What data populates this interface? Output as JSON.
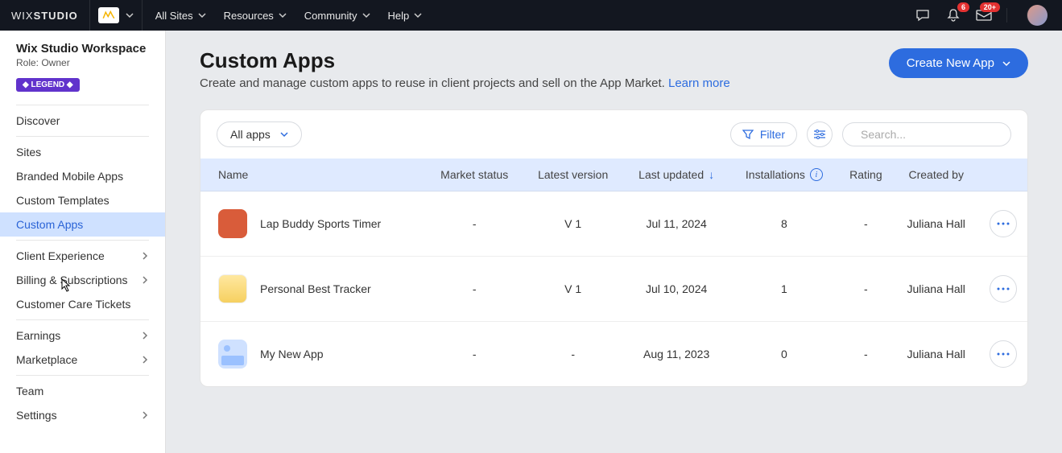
{
  "topbar": {
    "brand_prefix": "WIX ",
    "brand_bold": "STUDIO",
    "site_switch": "All Sites",
    "nav": [
      "Resources",
      "Community",
      "Help"
    ],
    "bell_badge": "6",
    "inbox_badge": "20+"
  },
  "sidebar": {
    "workspace": "Wix Studio Workspace",
    "role_label": "Role: Owner",
    "legend": "◆ LEGEND ◆",
    "groups": [
      {
        "items": [
          {
            "label": "Discover"
          }
        ]
      },
      {
        "items": [
          {
            "label": "Sites"
          },
          {
            "label": "Branded Mobile Apps"
          },
          {
            "label": "Custom Templates"
          },
          {
            "label": "Custom Apps",
            "active": true
          }
        ]
      },
      {
        "items": [
          {
            "label": "Client Experience",
            "chev": true
          },
          {
            "label": "Billing & Subscriptions",
            "chev": true
          },
          {
            "label": "Customer Care Tickets"
          }
        ]
      },
      {
        "items": [
          {
            "label": "Earnings",
            "chev": true
          },
          {
            "label": "Marketplace",
            "chev": true
          }
        ]
      },
      {
        "items": [
          {
            "label": "Team"
          },
          {
            "label": "Settings",
            "chev": true
          }
        ]
      }
    ]
  },
  "page": {
    "title": "Custom Apps",
    "desc": "Create and manage custom apps to reuse in client projects and sell on the App Market. ",
    "learn_more": "Learn more",
    "create_btn": "Create New App"
  },
  "toolbar": {
    "filter_dd": "All apps",
    "filter_btn": "Filter",
    "search_placeholder": "Search..."
  },
  "table": {
    "headers": {
      "name": "Name",
      "market": "Market status",
      "version": "Latest version",
      "updated": "Last updated",
      "installs": "Installations",
      "rating": "Rating",
      "creator": "Created by"
    },
    "rows": [
      {
        "icon": "orange",
        "name": "Lap Buddy Sports Timer",
        "market": "-",
        "version": "V 1",
        "updated": "Jul 11, 2024",
        "installs": "8",
        "rating": "-",
        "creator": "Juliana Hall"
      },
      {
        "icon": "trophy",
        "name": "Personal Best Tracker",
        "market": "-",
        "version": "V 1",
        "updated": "Jul 10, 2024",
        "installs": "1",
        "rating": "-",
        "creator": "Juliana Hall"
      },
      {
        "icon": "placeholder",
        "name": "My New App",
        "market": "-",
        "version": "-",
        "updated": "Aug 11, 2023",
        "installs": "0",
        "rating": "-",
        "creator": "Juliana Hall"
      }
    ]
  }
}
